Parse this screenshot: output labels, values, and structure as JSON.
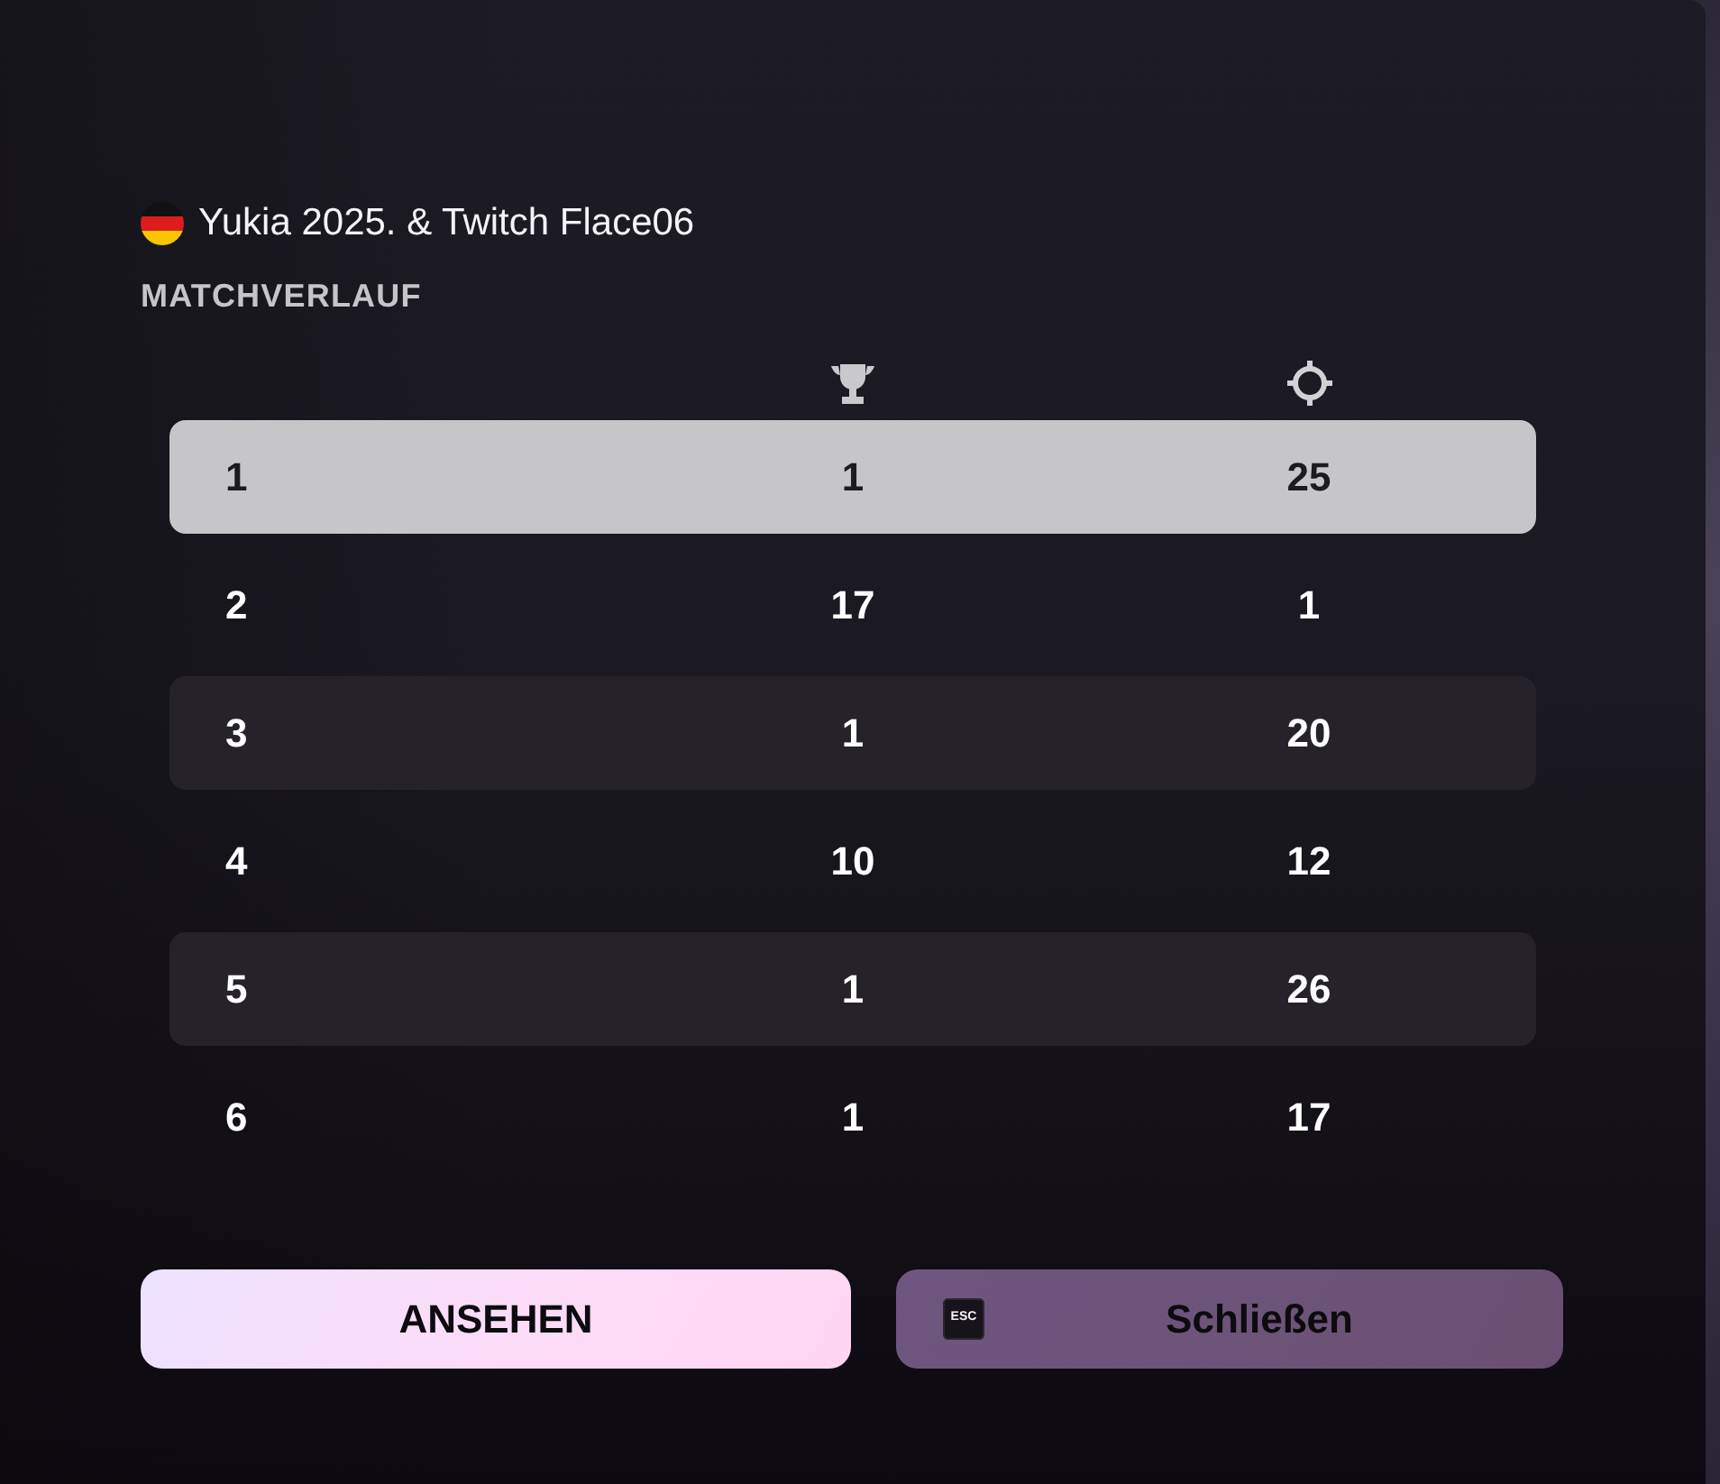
{
  "header": {
    "player": "Yukia 2025. & Twitch Flace06",
    "section_title": "MATCHVERLAUF"
  },
  "table": {
    "rows": [
      {
        "cells": [
          "1",
          "1",
          "25"
        ],
        "selected": true
      },
      {
        "cells": [
          "2",
          "17",
          "1"
        ],
        "selected": false
      },
      {
        "cells": [
          "3",
          "1",
          "20"
        ],
        "selected": false
      },
      {
        "cells": [
          "4",
          "10",
          "12"
        ],
        "selected": false
      },
      {
        "cells": [
          "5",
          "1",
          "26"
        ],
        "selected": false
      },
      {
        "cells": [
          "6",
          "1",
          "17"
        ],
        "selected": false
      }
    ]
  },
  "buttons": [
    {
      "kind": "primary",
      "label": "ANSEHEN"
    },
    {
      "kind": "secondary",
      "label": "Schließen",
      "key_hint": "ESC"
    }
  ]
}
